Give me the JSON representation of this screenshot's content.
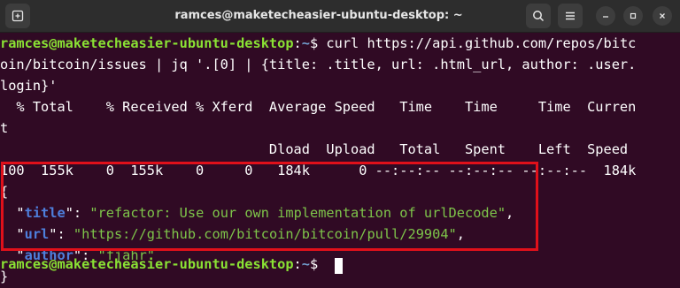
{
  "window": {
    "title": "ramces@maketecheasier-ubuntu-desktop: ~",
    "icons": [
      "new-tab-icon",
      "search-icon",
      "hamburger-menu-icon",
      "minimize-icon",
      "maximize-icon",
      "close-icon"
    ]
  },
  "colors": {
    "terminal_bg": "#300a24",
    "prompt_user": "#8ae234",
    "prompt_path": "#729fcf",
    "json_key": "#4e7fdc",
    "json_string": "#7ec54a",
    "highlight_border": "#e0101a"
  },
  "terminal": {
    "prompt": "ramces@maketecheasier-ubuntu-desktop",
    "prompt_colon": ":",
    "prompt_path": "~",
    "prompt_symbol": "$",
    "command_line1": " curl https://api.github.com/repos/bitc",
    "command_line2": "oin/bitcoin/issues | jq '.[0] | {title: .title, url: .html_url, author: .user.",
    "command_line3": "login}'",
    "progress_header1": "  % Total    % Received % Xferd  Average Speed   Time    Time     Time  Curren",
    "progress_header2": "t",
    "progress_header3": "                                 Dload  Upload   Total   Spent    Left  Speed",
    "progress_values": "100  155k    0  155k    0     0   184k      0 --:--:-- --:--:-- --:--:--  184k",
    "json_open": "{",
    "json_close": "}",
    "key_quote_open": "  \"",
    "quote_close": "\"",
    "colon_space": ": ",
    "comma": ",",
    "entries": [
      {
        "key": "title",
        "value": "\"refactor: Use our own implementation of urlDecode\"",
        "trail": ","
      },
      {
        "key": "url",
        "value": "\"https://github.com/bitcoin/bitcoin/pull/29904\"",
        "trail": ","
      },
      {
        "key": "author",
        "value": "\"fjahr\"",
        "trail": ""
      }
    ]
  }
}
